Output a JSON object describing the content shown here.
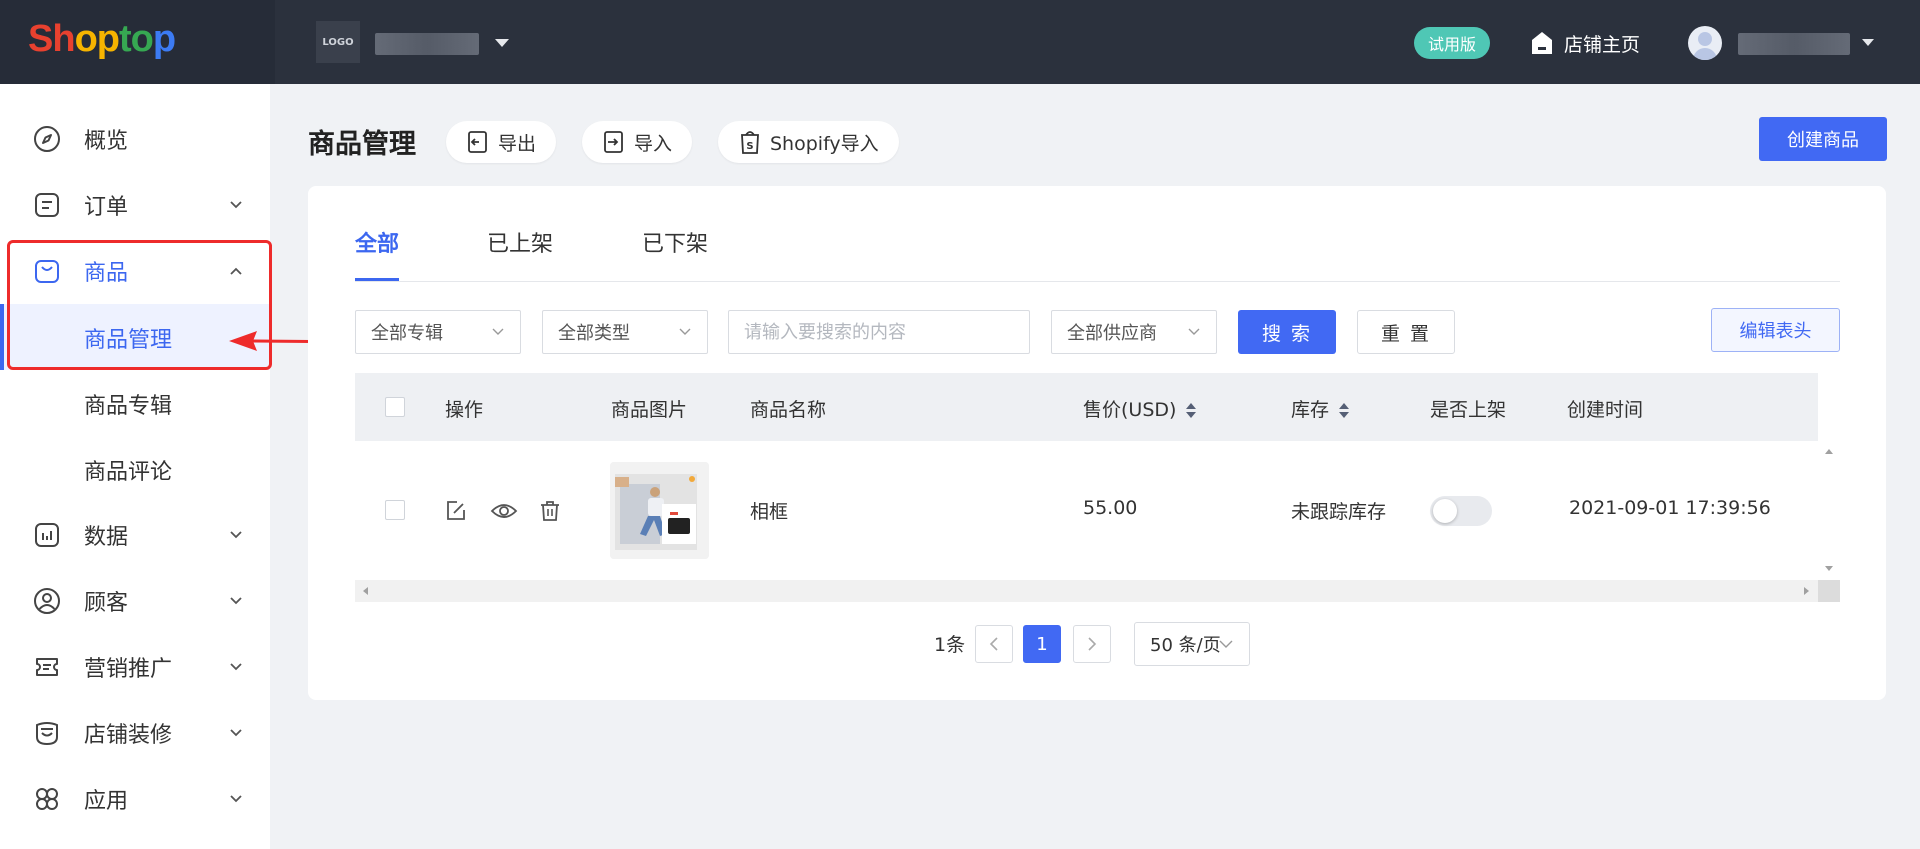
{
  "brand": {
    "logo_parts": [
      "Sh",
      "op",
      "to",
      "p"
    ]
  },
  "store": {
    "logo_label": "LOGO"
  },
  "header": {
    "trial_label": "试用版",
    "store_home_label": "店铺主页"
  },
  "sidebar": {
    "items": [
      {
        "label": "概览",
        "icon": "compass-icon"
      },
      {
        "label": "订单",
        "icon": "order-icon"
      },
      {
        "label": "商品",
        "icon": "bag-icon"
      },
      {
        "label": "数据",
        "icon": "chart-icon"
      },
      {
        "label": "顾客",
        "icon": "user-icon"
      },
      {
        "label": "营销推广",
        "icon": "ticket-icon"
      },
      {
        "label": "店铺装修",
        "icon": "store-decor-icon"
      },
      {
        "label": "应用",
        "icon": "apps-icon"
      }
    ],
    "product_subitems": [
      {
        "label": "商品管理"
      },
      {
        "label": "商品专辑"
      },
      {
        "label": "商品评论"
      }
    ]
  },
  "page": {
    "title": "商品管理",
    "export_label": "导出",
    "import_label": "导入",
    "shopify_import_label": "Shopify导入",
    "create_label": "创建商品"
  },
  "tabs": [
    {
      "label": "全部"
    },
    {
      "label": "已上架"
    },
    {
      "label": "已下架"
    }
  ],
  "filters": {
    "collection": "全部专辑",
    "type": "全部类型",
    "search_placeholder": "请输入要搜索的内容",
    "supplier": "全部供应商",
    "search_label": "搜 索",
    "reset_label": "重 置",
    "edit_header_label": "编辑表头"
  },
  "table": {
    "columns": [
      "操作",
      "商品图片",
      "商品名称",
      "售价(USD)",
      "库存",
      "是否上架",
      "创建时间"
    ],
    "rows": [
      {
        "name": "相框",
        "price": "55.00",
        "stock": "未跟踪库存",
        "published": false,
        "created": "2021-09-01 17:39:56"
      }
    ]
  },
  "pagination": {
    "total": "1条",
    "current_page": "1",
    "page_size": "50 条/页"
  },
  "colors": {
    "accent": "#4169f3",
    "sidebar_active": "#3c67f0",
    "annotation": "#ee2b2b",
    "trial": "#4fc7b5",
    "topbar": "#2b313d"
  }
}
